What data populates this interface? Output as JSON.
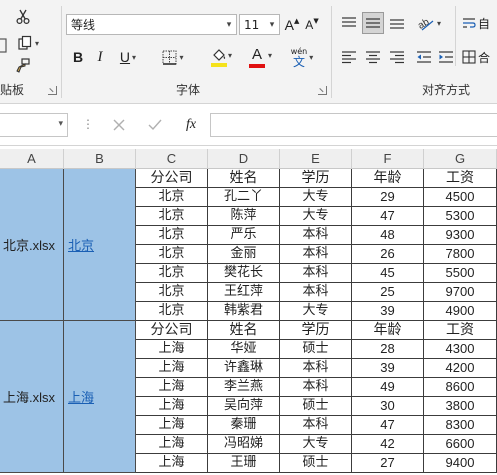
{
  "ribbon": {
    "clipboard": {
      "label": "贴板"
    },
    "font": {
      "name": "等线",
      "size": "11",
      "label": "字体",
      "bold_label": "B",
      "italic_label": "I",
      "underline_label": "U",
      "grow_label": "A",
      "shrink_label": "A",
      "font_color_label": "A",
      "phonetic_top": "wén",
      "phonetic_bottom": "文",
      "accent_yellow": "#f5e21b",
      "accent_red": "#e01010"
    },
    "alignment": {
      "label": "对齐方式",
      "wrap_label": "自",
      "merge_label": "合"
    }
  },
  "formula_bar": {
    "fx_label": "fx"
  },
  "columns": [
    "A",
    "B",
    "C",
    "D",
    "E",
    "F",
    "G"
  ],
  "blocks": [
    {
      "file": "北京.xlsx",
      "link": "北京",
      "header": [
        "分公司",
        "姓名",
        "学历",
        "年龄",
        "工资"
      ],
      "rows": [
        [
          "北京",
          "孔二丫",
          "大专",
          "29",
          "4500"
        ],
        [
          "北京",
          "陈萍",
          "大专",
          "47",
          "5300"
        ],
        [
          "北京",
          "严乐",
          "本科",
          "48",
          "9300"
        ],
        [
          "北京",
          "金丽",
          "本科",
          "26",
          "7800"
        ],
        [
          "北京",
          "樊花长",
          "本科",
          "45",
          "5500"
        ],
        [
          "北京",
          "王红萍",
          "本科",
          "25",
          "9700"
        ],
        [
          "北京",
          "韩紫君",
          "大专",
          "39",
          "4900"
        ]
      ]
    },
    {
      "file": "上海.xlsx",
      "link": "上海",
      "header": [
        "分公司",
        "姓名",
        "学历",
        "年龄",
        "工资"
      ],
      "rows": [
        [
          "上海",
          "华娅",
          "硕士",
          "28",
          "4300"
        ],
        [
          "上海",
          "许鑫琳",
          "本科",
          "39",
          "4200"
        ],
        [
          "上海",
          "李兰燕",
          "本科",
          "49",
          "8600"
        ],
        [
          "上海",
          "吴向萍",
          "硕士",
          "30",
          "3800"
        ],
        [
          "上海",
          "秦珊",
          "本科",
          "47",
          "8300"
        ],
        [
          "上海",
          "冯昭娣",
          "大专",
          "42",
          "6600"
        ],
        [
          "上海",
          "王珊",
          "硕士",
          "27",
          "9400"
        ]
      ]
    }
  ]
}
